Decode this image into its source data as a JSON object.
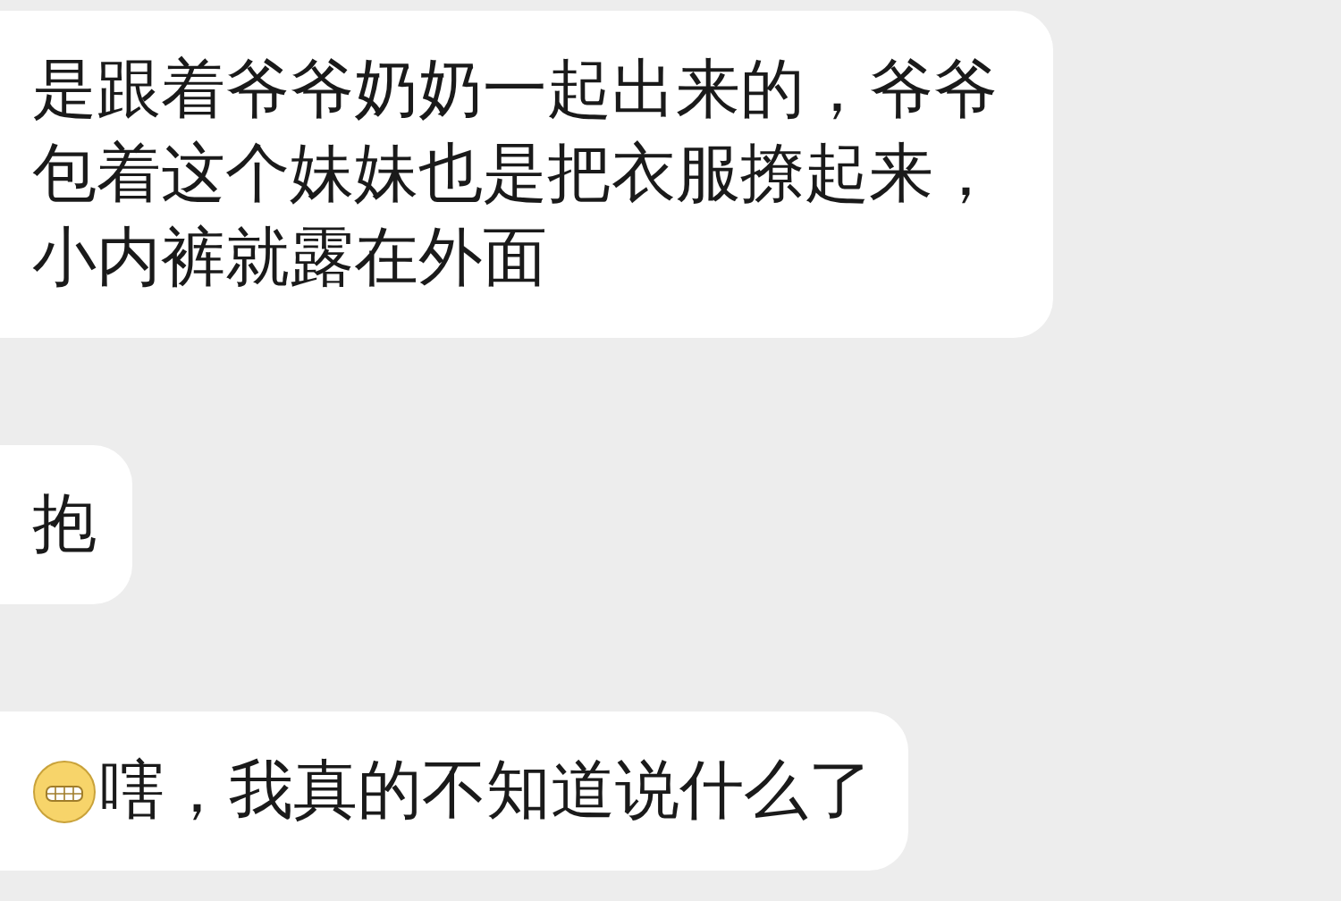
{
  "messages": [
    {
      "kind": "text",
      "text": "是跟着爷爷奶奶一起出来的，爷爷包着这个妹妹也是把衣服撩起来，小内裤就露在外面"
    },
    {
      "kind": "text",
      "text": "抱"
    },
    {
      "kind": "emoji-text",
      "text": "嗐，我真的不知道说什么了"
    }
  ]
}
